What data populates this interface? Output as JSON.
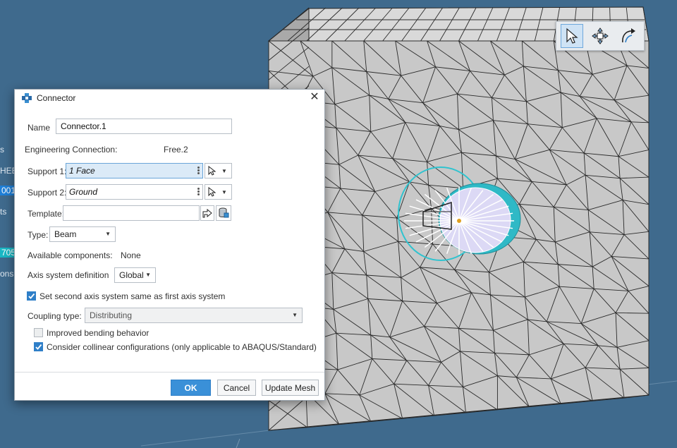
{
  "left_tree": [
    {
      "text": "s",
      "style": ""
    },
    {
      "text": "HEE",
      "style": ""
    },
    {
      "text": "001",
      "style": "hl"
    },
    {
      "text": "ts",
      "style": ""
    },
    {
      "text": "705",
      "style": "hl2"
    },
    {
      "text": "ons",
      "style": ""
    }
  ],
  "toolbar": {
    "select_icon": "cursor-arrow-icon",
    "pan_icon": "move-cross-icon",
    "rotate_icon": "rotate-arrow-icon"
  },
  "dialog": {
    "title": "Connector",
    "name_label": "Name",
    "name_value": "Connector.1",
    "eng_conn_label": "Engineering Connection:",
    "eng_conn_value": "Free.2",
    "support1_label": "Support 1:",
    "support1_value": "1 Face",
    "support2_label": "Support 2:",
    "support2_value": "Ground",
    "template_label": "Template:",
    "template_value": "",
    "type_label": "Type:",
    "type_value": "Beam",
    "avail_label": "Available components:",
    "avail_value": "None",
    "axis_label": "Axis system definition",
    "axis_value": "Global",
    "second_axis_label": "Set second axis system same as first axis system",
    "coupling_label": "Coupling type:",
    "coupling_value": "Distributing",
    "bending_label": "Improved bending behavior",
    "collinear_label": "Consider collinear configurations (only applicable to ABAQUS/Standard)",
    "ok_label": "OK",
    "cancel_label": "Cancel",
    "update_label": "Update Mesh",
    "second_axis_checked": true,
    "bending_checked": false,
    "collinear_checked": true
  },
  "colors": {
    "background": "#3f6a8d",
    "mesh_face": "#c9c9c9",
    "accent": "#3a90d8",
    "highlight": "#2fc3cf"
  }
}
